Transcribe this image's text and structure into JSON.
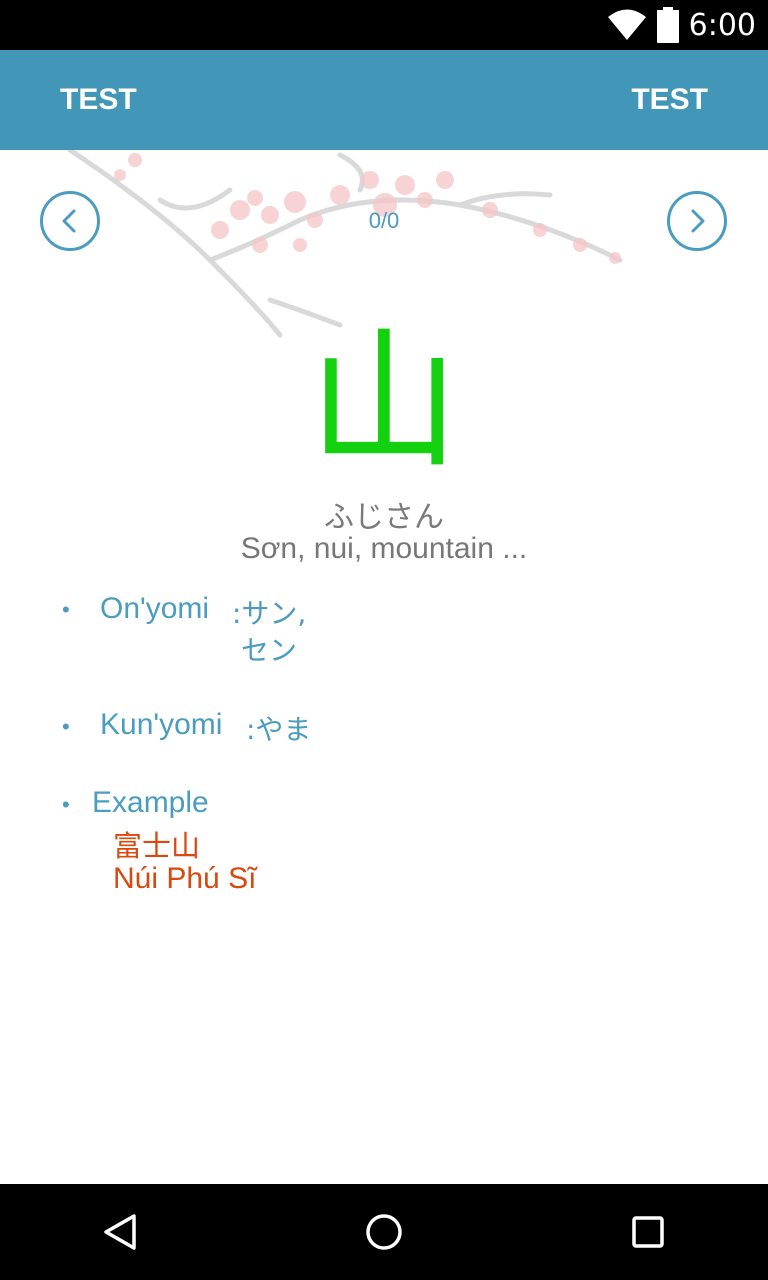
{
  "status_bar": {
    "time": "6:00",
    "icons": [
      "wifi-icon",
      "battery-icon"
    ]
  },
  "app_bar": {
    "left_label": "TEST",
    "right_label": "TEST",
    "color": "#4297b8"
  },
  "card": {
    "counter": "0/0",
    "kanji": "山",
    "reading": "ふじさん",
    "meaning": "Sơn, nui, mountain ...",
    "onyomi_label": "On'yomi",
    "onyomi_line1": ":サン,",
    "onyomi_line2": "セン",
    "kunyomi_label": "Kun'yomi",
    "kunyomi_value": ":やま",
    "example_label": "Example",
    "example_word": "富士山",
    "example_translation": "Núi Phú Sĩ",
    "bullet": "•"
  },
  "colors": {
    "kanji": "#13d10f",
    "info": "#4a9cc0",
    "example": "#d9480f",
    "muted_text": "#777777"
  },
  "nav_bar": {
    "icons": [
      "back-triangle-icon",
      "home-circle-icon",
      "recents-square-icon"
    ]
  }
}
